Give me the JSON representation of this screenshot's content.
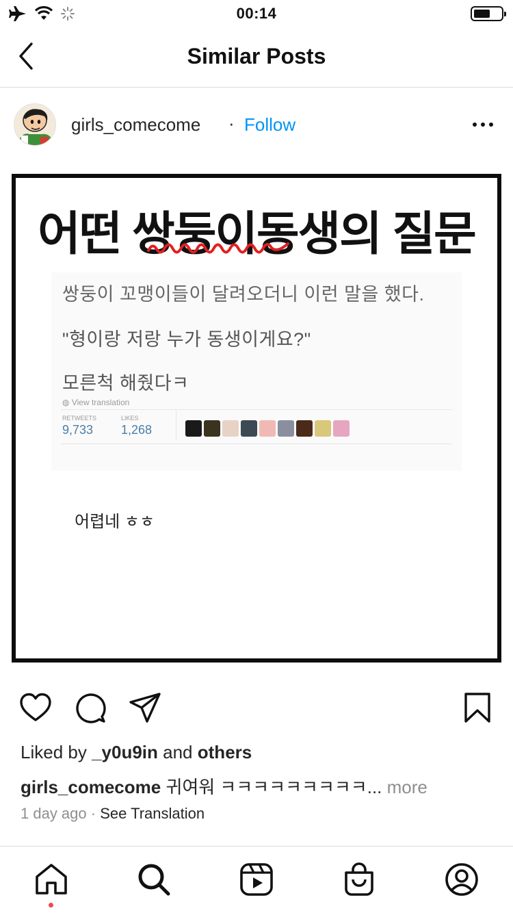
{
  "status_bar": {
    "time": "00:14",
    "icons": [
      "airplane-mode-icon",
      "wifi-icon",
      "loading-icon",
      "battery-icon"
    ]
  },
  "nav": {
    "title": "Similar Posts",
    "back_icon": "chevron-left-icon"
  },
  "post": {
    "username": "girls_comecome",
    "separator": "·",
    "follow_label": "Follow",
    "more_icon": "more-horizontal-icon",
    "image": {
      "headline": "어떤 쌍둥이동생의 질문",
      "tweet_lines": [
        "쌍둥이 꼬맹이들이 달려오더니 이런 말을 했다.",
        "\"형이랑 저랑 누가 동생이게요?\"",
        "모른척 해줬다ㅋ"
      ],
      "view_translation": "View translation",
      "retweets_label": "RETWEETS",
      "retweets_value": "9,733",
      "likes_label": "LIKES",
      "likes_value": "1,268",
      "bottom_caption": "어렵네 ㅎㅎ"
    },
    "actions": [
      "heart-icon",
      "comment-icon",
      "share-icon",
      "bookmark-icon"
    ],
    "liked_by_prefix": "Liked by",
    "liked_by_user": "_y0u9in",
    "liked_by_and": "and",
    "liked_by_others": "others",
    "caption_user": "girls_comecome",
    "caption_text": "귀여워 ㅋㅋㅋㅋㅋㅋㅋㅋㅋ...",
    "caption_more": "more",
    "time_ago": "1 day ago",
    "see_translation": "See Translation"
  },
  "tab_bar": {
    "items": [
      "home-icon",
      "search-icon",
      "reels-icon",
      "shop-icon",
      "profile-icon"
    ],
    "active_dot_color": "#ed4956"
  },
  "colors": {
    "link_blue": "#0095f6",
    "muted_gray": "#8e8e8e",
    "squiggle_red": "#e02020",
    "stat_blue": "#4a7ea8"
  }
}
